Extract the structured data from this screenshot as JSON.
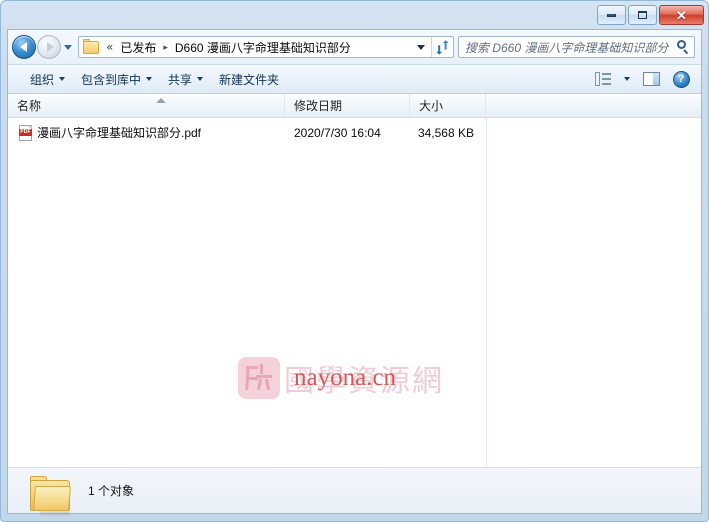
{
  "window": {
    "controls": {
      "minimize_label": "–",
      "maximize_label": "□",
      "close_label": "✕"
    }
  },
  "nav": {
    "back_tooltip": "后退",
    "forward_tooltip": "前进",
    "recent_tooltip": "最近浏览的位置",
    "breadcrumb_overflow": "«",
    "breadcrumb": [
      {
        "label": "已发布"
      },
      {
        "label": "D660 漫画八字命理基础知识部分"
      }
    ],
    "separator": "▸",
    "refresh_tooltip": "刷新"
  },
  "search": {
    "placeholder": "搜索 D660 漫画八字命理基础知识部分",
    "value": ""
  },
  "toolbar": {
    "items": [
      {
        "label": "组织",
        "has_caret": true
      },
      {
        "label": "包含到库中",
        "has_caret": true
      },
      {
        "label": "共享",
        "has_caret": true
      },
      {
        "label": "新建文件夹",
        "has_caret": false
      }
    ],
    "view_mode_tooltip": "更改您的视图",
    "preview_pane_tooltip": "显示预览窗格",
    "help_label": "?"
  },
  "columns": [
    {
      "label": "名称",
      "sorted": "asc"
    },
    {
      "label": "修改日期",
      "sorted": ""
    },
    {
      "label": "大小",
      "sorted": ""
    }
  ],
  "files": [
    {
      "icon": "pdf-file-icon",
      "icon_label": "PDF",
      "name": "漫画八字命理基础知识部分.pdf",
      "date": "2020/7/30 16:04",
      "size": "34,568 KB"
    }
  ],
  "watermark": {
    "cn_text": "國學資源網",
    "url_text": "nayona.cn"
  },
  "status": {
    "text": "1 个对象"
  },
  "colors": {
    "frame": "#c3d7eb",
    "accent_blue": "#2c6bab",
    "close_red": "#cf3e28",
    "pdf_red": "#cf2a27",
    "folder_yellow": "#f3cf74",
    "watermark_pink": "#f0cdd4",
    "watermark_red": "#d45a5a"
  }
}
